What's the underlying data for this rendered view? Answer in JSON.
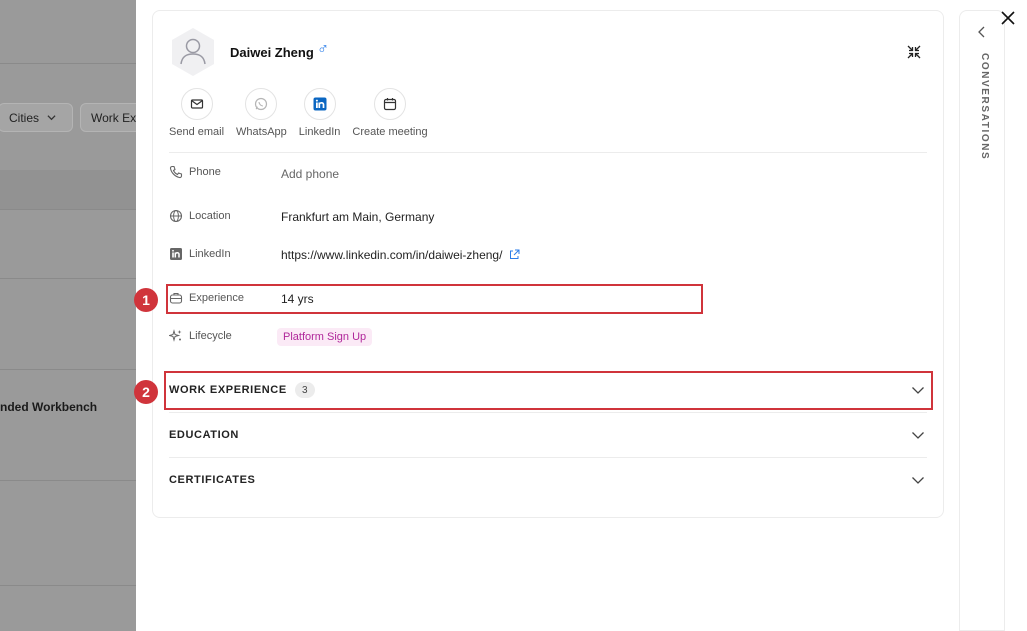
{
  "background": {
    "filters": [
      "Cities",
      "Work Ex"
    ],
    "row_text": "nded Workbench"
  },
  "profile": {
    "name": "Daiwei Zheng",
    "gender_symbol": "♂"
  },
  "actions": [
    {
      "label": "Send email",
      "icon": "mail-icon"
    },
    {
      "label": "WhatsApp",
      "icon": "whatsapp-icon"
    },
    {
      "label": "LinkedIn",
      "icon": "linkedin-icon"
    },
    {
      "label": "Create meeting",
      "icon": "calendar-icon"
    }
  ],
  "fields": {
    "phone": {
      "label": "Phone",
      "value": "Add phone"
    },
    "location": {
      "label": "Location",
      "value": "Frankfurt am Main, Germany"
    },
    "linkedin": {
      "label": "LinkedIn",
      "value": "https://www.linkedin.com/in/daiwei-zheng/"
    },
    "experience": {
      "label": "Experience",
      "value": "14 yrs"
    },
    "lifecycle": {
      "label": "Lifecycle",
      "value": "Platform Sign Up"
    }
  },
  "sections": {
    "work_experience": {
      "title": "WORK EXPERIENCE",
      "count": "3"
    },
    "education": {
      "title": "EDUCATION"
    },
    "certificates": {
      "title": "CERTIFICATES"
    }
  },
  "markers": [
    "1",
    "2"
  ],
  "rail": {
    "label": "CONVERSATIONS"
  },
  "colors": {
    "accent_red": "#d0343b",
    "tag_bg": "#fbeaf6",
    "tag_text": "#b0279a",
    "linkedin_blue": "#0a66c2"
  }
}
